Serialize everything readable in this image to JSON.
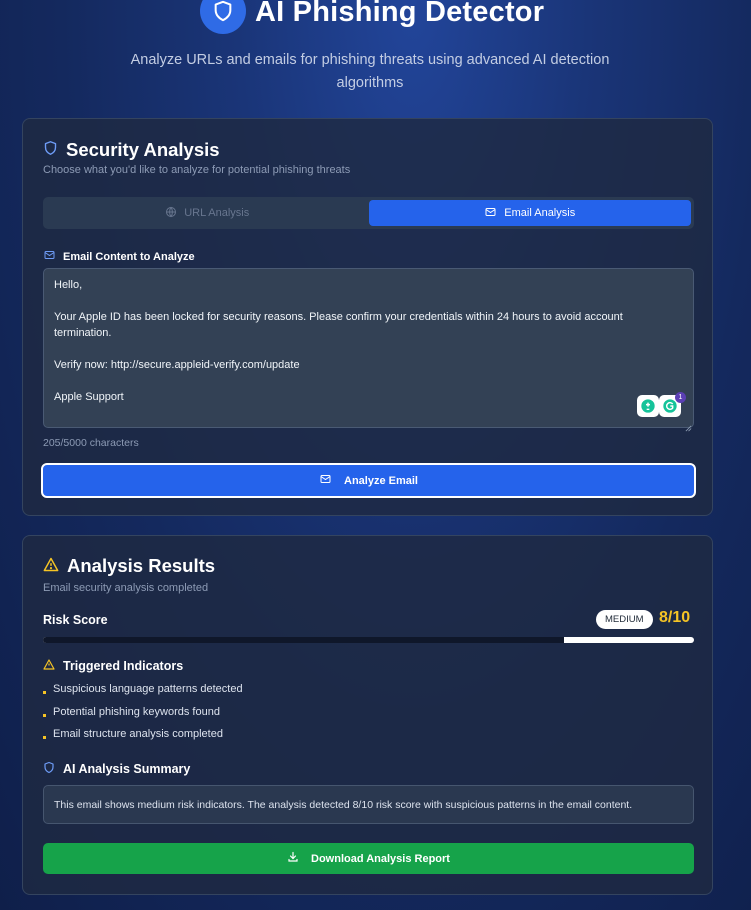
{
  "header": {
    "title": "AI Phishing Detector",
    "subtitle": "Analyze URLs and emails for phishing threats using advanced AI detection algorithms",
    "logo_icon": "shield-icon",
    "accent_color": "#2f6be6"
  },
  "analysis_card": {
    "title": "Security Analysis",
    "description": "Choose what you'd like to analyze for potential phishing threats",
    "tabs": [
      {
        "label": "URL Analysis",
        "icon": "globe-icon",
        "active": false
      },
      {
        "label": "Email Analysis",
        "icon": "mail-icon",
        "active": true
      }
    ],
    "field_label": "Email Content to Analyze",
    "email_content": "Hello,\n\nYour Apple ID has been locked for security reasons. Please confirm your credentials within 24 hours to avoid account termination.\n\nVerify now: http://secure.appleid-verify.com/update\n\nApple Support",
    "grammarly_badge_count": "1",
    "char_count": "205/5000 characters",
    "analyze_button_label": "Analyze Email"
  },
  "results_card": {
    "title": "Analysis Results",
    "description": "Email security analysis completed",
    "risk_label": "Risk Score",
    "risk_level": "MEDIUM",
    "risk_score": "8/10",
    "risk_fraction": 0.8,
    "indicators_heading": "Triggered Indicators",
    "indicators": [
      "Suspicious language patterns detected",
      "Potential phishing keywords found",
      "Email structure analysis completed"
    ],
    "summary_heading": "AI Analysis Summary",
    "summary_text": "This email shows medium risk indicators. The analysis detected 8/10 risk score with suspicious patterns in the email content.",
    "download_button_label": "Download Analysis Report",
    "warning_color": "#f5c425",
    "success_color": "#16a34a"
  }
}
